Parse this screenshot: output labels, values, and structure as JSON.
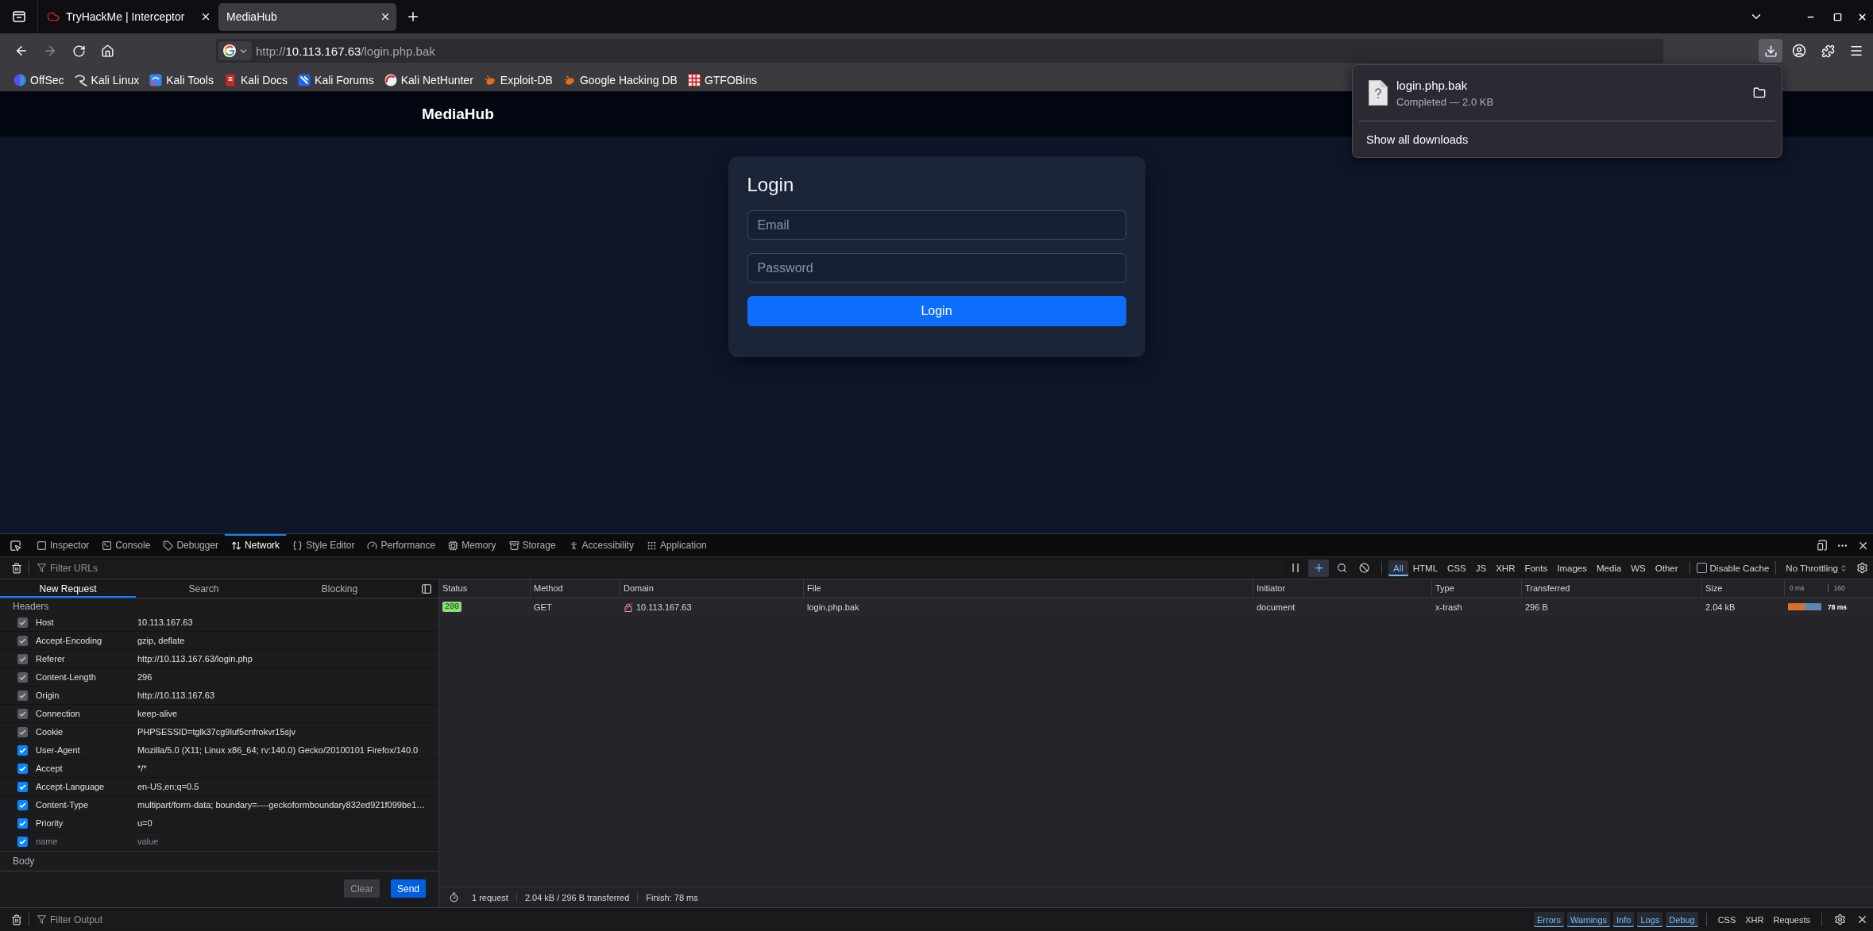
{
  "browser": {
    "tabs": [
      {
        "title": "TryHackMe | Interceptor",
        "favicon": true,
        "selected": false
      },
      {
        "title": "MediaHub",
        "favicon": false,
        "selected": true
      }
    ],
    "navigation": {
      "back_disabled": false,
      "forward_disabled": true
    },
    "address": {
      "scheme": "http://",
      "host": "10.113.167.63",
      "path": "/login.php.bak"
    },
    "bookmarks": [
      {
        "label": "OffSec"
      },
      {
        "label": "Kali Linux"
      },
      {
        "label": "Kali Tools"
      },
      {
        "label": "Kali Docs"
      },
      {
        "label": "Kali Forums"
      },
      {
        "label": "Kali NetHunter"
      },
      {
        "label": "Exploit-DB"
      },
      {
        "label": "Google Hacking DB"
      },
      {
        "label": "GTFOBins"
      }
    ]
  },
  "downloads_panel": {
    "open": true,
    "items": [
      {
        "filename": "login.php.bak",
        "status": "Completed — 2.0 KB"
      }
    ],
    "footer": "Show all downloads"
  },
  "page": {
    "brand": "MediaHub",
    "login": {
      "title": "Login",
      "fields": [
        {
          "placeholder": "Email"
        },
        {
          "placeholder": "Password"
        }
      ],
      "button": "Login"
    }
  },
  "devtools": {
    "tabs": [
      {
        "label": "Inspector",
        "selected": false
      },
      {
        "label": "Console",
        "selected": false
      },
      {
        "label": "Debugger",
        "selected": false
      },
      {
        "label": "Network",
        "selected": true
      },
      {
        "label": "Style Editor",
        "selected": false
      },
      {
        "label": "Performance",
        "selected": false
      },
      {
        "label": "Memory",
        "selected": false
      },
      {
        "label": "Storage",
        "selected": false
      },
      {
        "label": "Accessibility",
        "selected": false
      },
      {
        "label": "Application",
        "selected": false
      }
    ],
    "filter_placeholder": "Filter URLs",
    "new_request_button": {
      "pressed": true
    },
    "type_filters": [
      {
        "label": "All",
        "selected": true
      },
      {
        "label": "HTML",
        "selected": false
      },
      {
        "label": "CSS",
        "selected": false
      },
      {
        "label": "JS",
        "selected": false
      },
      {
        "label": "XHR",
        "selected": false
      },
      {
        "label": "Fonts",
        "selected": false
      },
      {
        "label": "Images",
        "selected": false
      },
      {
        "label": "Media",
        "selected": false
      },
      {
        "label": "WS",
        "selected": false
      },
      {
        "label": "Other",
        "selected": false
      }
    ],
    "disable_cache": {
      "label": "Disable Cache",
      "checked": false
    },
    "throttling": "No Throttling",
    "sidebar": {
      "tabs": [
        {
          "label": "New Request",
          "selected": true
        },
        {
          "label": "Search",
          "selected": false
        },
        {
          "label": "Blocking",
          "selected": false
        }
      ],
      "section_label": "Headers",
      "headers": [
        {
          "name": "Host",
          "value": "10.113.167.63",
          "checked": true,
          "disabled": true
        },
        {
          "name": "Accept-Encoding",
          "value": "gzip, deflate",
          "checked": true,
          "disabled": true
        },
        {
          "name": "Referer",
          "value": "http://10.113.167.63/login.php",
          "checked": true,
          "disabled": true
        },
        {
          "name": "Content-Length",
          "value": "296",
          "checked": true,
          "disabled": true
        },
        {
          "name": "Origin",
          "value": "http://10.113.167.63",
          "checked": true,
          "disabled": true
        },
        {
          "name": "Connection",
          "value": "keep-alive",
          "checked": true,
          "disabled": true
        },
        {
          "name": "Cookie",
          "value": "PHPSESSID=tglk37cg9luf5cnfrokvr15sjv",
          "checked": true,
          "disabled": true
        },
        {
          "name": "User-Agent",
          "value": "Mozilla/5.0 (X11; Linux x86_64; rv:140.0) Gecko/20100101 Firefox/140.0",
          "checked": true,
          "disabled": false
        },
        {
          "name": "Accept",
          "value": "*/*",
          "checked": true,
          "disabled": false
        },
        {
          "name": "Accept-Language",
          "value": "en-US,en;q=0.5",
          "checked": true,
          "disabled": false
        },
        {
          "name": "Content-Type",
          "value": "multipart/form-data; boundary=----geckoformboundary832ed921f099be1…",
          "checked": true,
          "disabled": false
        },
        {
          "name": "Priority",
          "value": "u=0",
          "checked": true,
          "disabled": false
        }
      ],
      "new_header": {
        "name_placeholder": "name",
        "value_placeholder": "value",
        "checked": true
      },
      "body_label": "Body",
      "buttons": [
        {
          "label": "Clear",
          "kind": "secondary"
        },
        {
          "label": "Send",
          "kind": "primary"
        }
      ]
    },
    "table": {
      "columns": [
        "Status",
        "Method",
        "Domain",
        "File",
        "Initiator",
        "Type",
        "Transferred",
        "Size"
      ],
      "timeline_ticks": [
        "0 ms",
        "160"
      ],
      "rows": [
        {
          "status": "200",
          "method": "GET",
          "domain": "10.113.167.63",
          "file": "login.php.bak",
          "initiator": "document",
          "type": "x-trash",
          "transferred": "296 B",
          "size": "2.04 kB",
          "time": "78 ms",
          "selected": false
        }
      ]
    },
    "summary": [
      "1 request",
      "2.04 kB / 296 B transferred",
      "Finish: 78 ms"
    ],
    "console_bar": {
      "filter_placeholder": "Filter Output",
      "levels": [
        {
          "label": "Errors",
          "selected": true
        },
        {
          "label": "Warnings",
          "selected": true
        },
        {
          "label": "Info",
          "selected": true
        },
        {
          "label": "Logs",
          "selected": true
        },
        {
          "label": "Debug",
          "selected": true
        }
      ],
      "extras": [
        {
          "label": "CSS",
          "selected": false
        },
        {
          "label": "XHR",
          "selected": false
        },
        {
          "label": "Requests",
          "selected": false
        }
      ]
    }
  }
}
